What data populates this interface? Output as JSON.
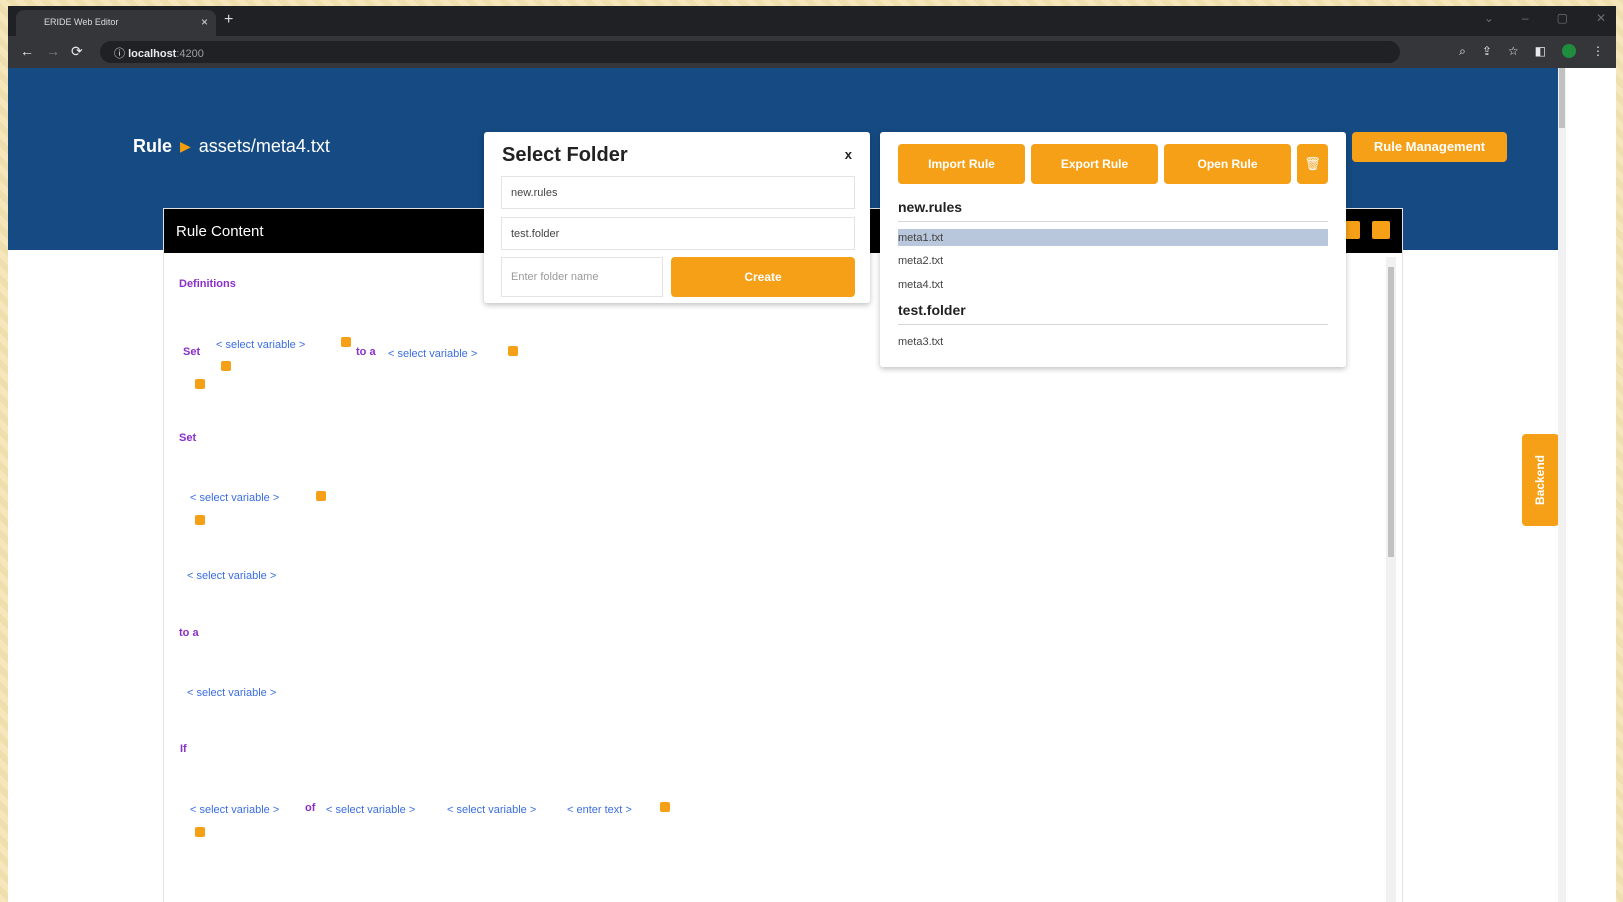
{
  "browser": {
    "tab_title": "ERIDE Web Editor",
    "tab_close": "×",
    "new_tab": "+",
    "url_host": "localhost",
    "url_port": ":4200",
    "back": "←",
    "forward": "→",
    "reload": "⟳",
    "info": "ⓘ",
    "addr_icons": [
      "⌕",
      "⇪",
      "☆",
      "◧"
    ],
    "menu": "⋮",
    "win_controls": [
      "⌄",
      "–",
      "▢",
      "✕"
    ]
  },
  "header": {
    "crumb_root": "Rule",
    "crumb_arrow": "▶",
    "crumb_path": "assets/meta4.txt",
    "rule_management": "Rule Management"
  },
  "content": {
    "title": "Rule Content",
    "definitions": "Definitions",
    "set": "Set",
    "to_a": "to a",
    "if": "If",
    "of": "of",
    "select_variable": "< select variable >",
    "enter_text": "< enter text >"
  },
  "dialog": {
    "title": "Select Folder",
    "close": "x",
    "folders": [
      "new.rules",
      "test.folder"
    ],
    "folder_name_placeholder": "Enter folder name",
    "create": "Create"
  },
  "rule_panel": {
    "buttons": {
      "import": "Import Rule",
      "export": "Export Rule",
      "open": "Open Rule",
      "delete_icon": "🗑"
    },
    "folders": [
      {
        "name": "new.rules",
        "files": [
          "meta1.txt",
          "meta2.txt",
          "meta4.txt"
        ],
        "selected": 0
      },
      {
        "name": "test.folder",
        "files": [
          "meta3.txt"
        ]
      }
    ]
  },
  "side": {
    "backend": "Backend"
  },
  "colors": {
    "header": "#154a82",
    "accent": "#f5a017",
    "keyword": "#8b2fc9",
    "variable": "#3b6ee0"
  }
}
